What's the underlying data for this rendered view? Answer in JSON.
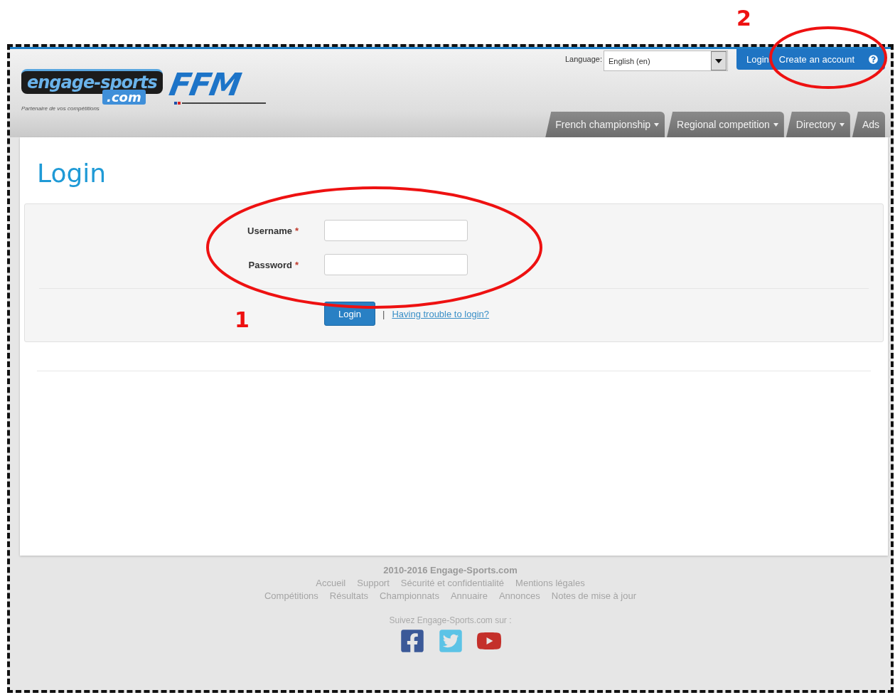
{
  "header": {
    "logo": {
      "name": "engage-sports",
      "suffix": ".com",
      "tagline": "Partenaire de vos compétitions"
    },
    "partner_logo": {
      "name": "FFM"
    },
    "language": {
      "label": "Language:",
      "value": "English (en)"
    },
    "account_bar": [
      {
        "label": "Login"
      },
      {
        "label": "Create an account"
      }
    ],
    "nav_tabs": [
      {
        "label": "French championship",
        "dropdown": true
      },
      {
        "label": "Regional competition",
        "dropdown": true
      },
      {
        "label": "Directory",
        "dropdown": true
      },
      {
        "label": "Ads",
        "dropdown": false
      }
    ]
  },
  "page_title": "Login",
  "form": {
    "fields": [
      {
        "label": "Username",
        "required_mark": "*"
      },
      {
        "label": "Password",
        "required_mark": "*"
      }
    ],
    "submit": "Login",
    "separator": "|",
    "help_link": "Having trouble to login?"
  },
  "footer": {
    "copyright": "2010-2016 Engage-Sports.com",
    "link_rows": [
      [
        "Accueil",
        "Support",
        "Sécurité et confidentialité",
        "Mentions légales"
      ],
      [
        "Compétitions",
        "Résultats",
        "Championnats",
        "Annuaire",
        "Annonces",
        "Notes de mise à jour"
      ]
    ],
    "follow": "Suivez Engage-Sports.com sur :",
    "social": [
      {
        "kind": "facebook"
      },
      {
        "kind": "twitter"
      },
      {
        "kind": "youtube"
      }
    ]
  },
  "annotations": [
    {
      "label": "2"
    },
    {
      "label": "1"
    }
  ]
}
